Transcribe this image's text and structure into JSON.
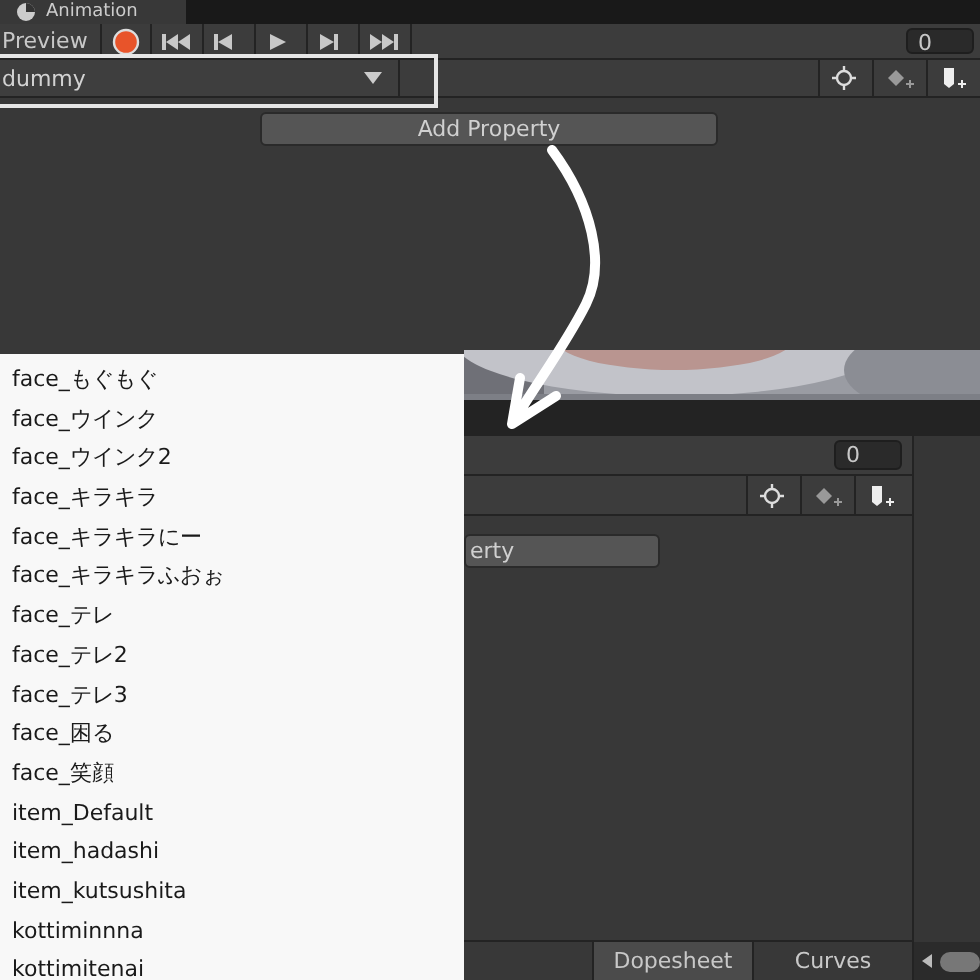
{
  "window": {
    "title": "Animation"
  },
  "toolbar": {
    "preview": "Preview",
    "record": {
      "on": true
    },
    "transport": [
      {
        "kind": "first"
      },
      {
        "kind": "prev"
      },
      {
        "kind": "play"
      },
      {
        "kind": "next"
      },
      {
        "kind": "last"
      }
    ],
    "frame": "0"
  },
  "property_row": {
    "clip": "dummy",
    "highlighted": true,
    "tools": [
      {
        "kind": "frame"
      },
      {
        "kind": "key"
      },
      {
        "kind": "event"
      }
    ]
  },
  "add_property": "Add Property",
  "lower_window": {
    "frame": "0",
    "tools": [
      {
        "kind": "frame"
      },
      {
        "kind": "key"
      },
      {
        "kind": "event"
      }
    ],
    "add_property": "erty",
    "tabs": [
      {
        "label": "Dopesheet",
        "selected": true
      },
      {
        "label": "Curves",
        "selected": false
      }
    ]
  },
  "popup": {
    "items": [
      "face_もぐもぐ",
      "face_ウインク",
      "face_ウインク2",
      "face_キラキラ",
      "face_キラキラにー",
      "face_キラキラふおぉ",
      "face_テレ",
      "face_テレ2",
      "face_テレ3",
      "face_困る",
      "face_笑顔",
      "item_Default",
      "item_hadashi",
      "item_kutsushita",
      "kottiminnna",
      "kottimitenai"
    ]
  }
}
